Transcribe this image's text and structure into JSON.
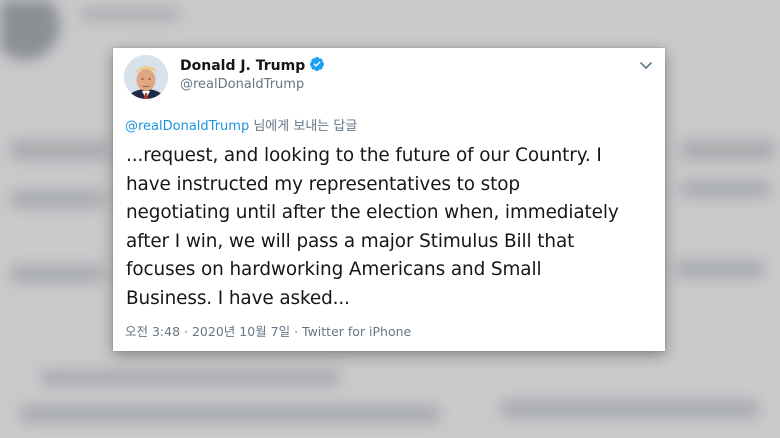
{
  "tweet": {
    "display_name": "Donald J. Trump",
    "handle": "@realDonaldTrump",
    "reply_to_mention": "@realDonaldTrump",
    "reply_to_suffix": "님에게 보내는 답글",
    "body_lines": [
      "...request, and looking to the future of our Country. I",
      "have instructed my representatives to stop",
      "negotiating until after the election when, immediately",
      "after I win, we will pass a major Stimulus Bill that",
      "focuses on hardworking Americans and Small",
      "Business. I have asked..."
    ],
    "time": "오전 3:48",
    "date": "2020년 10월 7일",
    "source": "Twitter for iPhone",
    "separator": " · "
  },
  "icons": {
    "verified": "verified-badge-icon",
    "menu": "chevron-down-icon"
  },
  "colors": {
    "verified_blue": "#1da1f2",
    "link_blue": "#1b95e0",
    "text_primary": "#14171a",
    "text_secondary": "#657786"
  }
}
